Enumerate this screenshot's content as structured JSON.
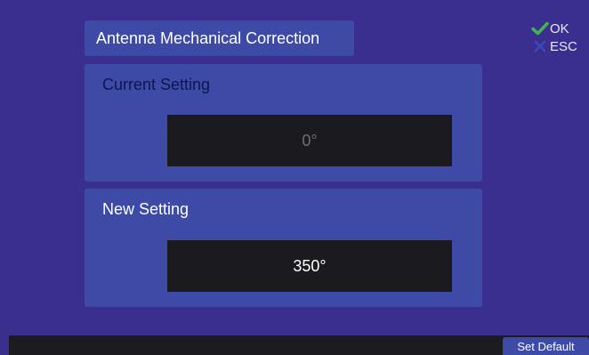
{
  "title": "Antenna Mechanical Correction",
  "keys": {
    "ok_label": "OK",
    "esc_label": "ESC",
    "ok_icon": "check-icon",
    "esc_icon": "x-icon",
    "ok_color": "#3fb54a",
    "esc_color": "#3a4ab8"
  },
  "current": {
    "label": "Current Setting",
    "value": "0°"
  },
  "new": {
    "label": "New Setting",
    "value": "350°"
  },
  "footer": {
    "set_default_label": "Set Default"
  },
  "colors": {
    "background": "#3a2f8f",
    "panel": "#3d4aa6",
    "value_box": "#1b1b1f"
  }
}
